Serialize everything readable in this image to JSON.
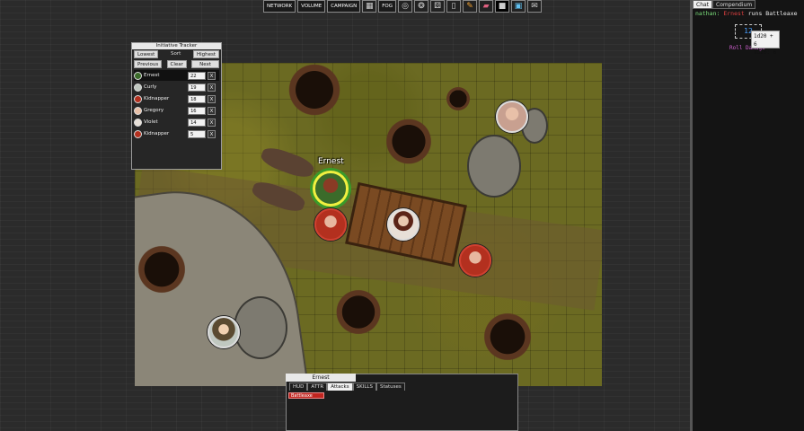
{
  "toolbar": {
    "buttons": [
      "NETWORK",
      "VOLUME",
      "CAMPAIGN"
    ],
    "fog_label": "FOG",
    "icons": [
      "grid-icon",
      "circle-icon",
      "sparkle-icon",
      "dice-icon",
      "door-icon",
      "pencil-icon",
      "eraser-icon",
      "black-square-icon",
      "picture-icon",
      "envelope-icon"
    ]
  },
  "tracker": {
    "title": "Initiative Tracker",
    "lowest": "Lowest",
    "sort": "Sort",
    "highest": "Highest",
    "previous": "Previous",
    "clear": "Clear",
    "next": "Next",
    "entries": [
      {
        "name": "Ernest",
        "value": "22",
        "x": "X"
      },
      {
        "name": "Curly",
        "value": "19",
        "x": "X"
      },
      {
        "name": "Kidnapper",
        "value": "18",
        "x": "X"
      },
      {
        "name": "Gregory",
        "value": "16",
        "x": "X"
      },
      {
        "name": "Violet",
        "value": "14",
        "x": "X"
      },
      {
        "name": "Kidnapper",
        "value": "5",
        "x": "X"
      }
    ]
  },
  "map": {
    "selected_token_label": "Ernest"
  },
  "character_panel": {
    "name": "Ernest",
    "tabs": [
      "HUD",
      "ATTR",
      "Attacks",
      "SKILLS",
      "Statuses"
    ],
    "active_tab": "Attacks",
    "attack_button": "Battleaxe"
  },
  "chat": {
    "tabs": [
      "Chat",
      "Compendium"
    ],
    "user": "nathan:",
    "character": "Ernest",
    "action": "runs Battleaxe",
    "roll_result": "12",
    "tooltip_line1": "1d20 + 6",
    "tooltip_line2": "1d20: 6",
    "roll_sub": "Roll Damage"
  }
}
